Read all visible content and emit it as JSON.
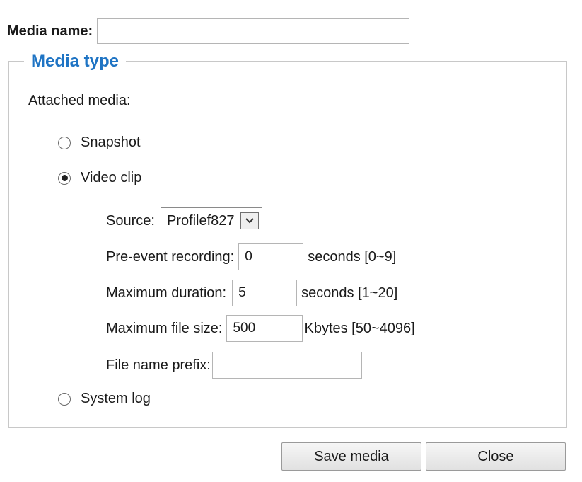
{
  "media_name": {
    "label": "Media name:",
    "value": ""
  },
  "media_type": {
    "legend": "Media type",
    "attached_label": "Attached media:",
    "options": {
      "snapshot": {
        "label": "Snapshot",
        "selected": false
      },
      "video_clip": {
        "label": "Video clip",
        "selected": true
      },
      "system_log": {
        "label": "System log",
        "selected": false
      }
    },
    "video": {
      "source_label": "Source:",
      "source_value": "Profilef827",
      "pre_event_label": "Pre-event recording:",
      "pre_event_value": "0",
      "pre_event_unit": "seconds [0~9]",
      "max_duration_label": "Maximum duration:",
      "max_duration_value": "5",
      "max_duration_unit": "seconds [1~20]",
      "max_file_size_label": "Maximum file size:",
      "max_file_size_value": "500",
      "max_file_size_unit": "Kbytes [50~4096]",
      "prefix_label": "File name prefix:",
      "prefix_value": ""
    }
  },
  "buttons": {
    "save": "Save media",
    "close": "Close"
  },
  "colors": {
    "legend_accent": "#1f74c4"
  },
  "icons": {
    "dropdown": "chevron-down-icon"
  }
}
